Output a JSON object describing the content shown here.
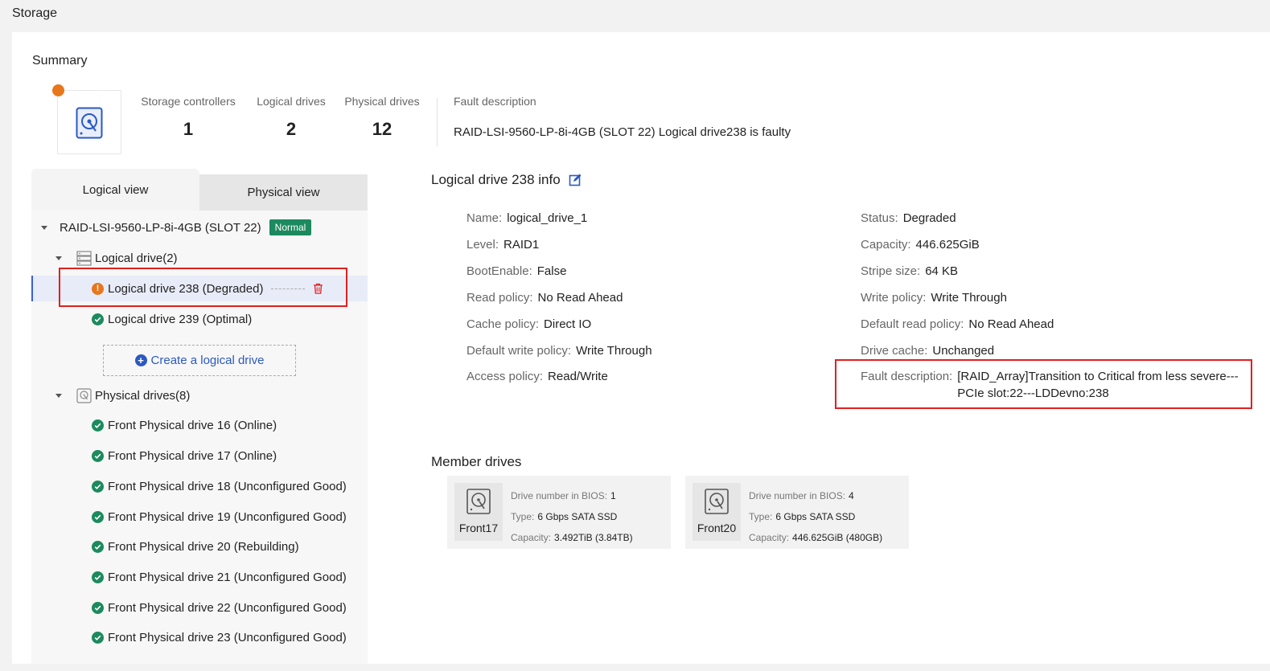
{
  "page": {
    "title": "Storage"
  },
  "summary": {
    "title": "Summary",
    "stats": [
      {
        "label": "Storage controllers",
        "value": "1"
      },
      {
        "label": "Logical drives",
        "value": "2"
      },
      {
        "label": "Physical drives",
        "value": "12"
      }
    ],
    "fault_label": "Fault description",
    "fault_value": "RAID-LSI-9560-LP-8i-4GB (SLOT 22) Logical drive238 is faulty"
  },
  "tabs": {
    "logical": "Logical view",
    "physical": "Physical view"
  },
  "tree": {
    "controller": "RAID-LSI-9560-LP-8i-4GB (SLOT 22)",
    "controller_badge": "Normal",
    "logical_group": "Logical drive(2)",
    "logical_items": [
      "Logical drive 238 (Degraded)",
      "Logical drive 239 (Optimal)"
    ],
    "create_label": "Create a logical drive",
    "physical_group": "Physical drives(8)",
    "physical_items": [
      "Front Physical drive 16 (Online)",
      "Front Physical drive 17 (Online)",
      "Front Physical drive 18 (Unconfigured Good)",
      "Front Physical drive 19 (Unconfigured Good)",
      "Front Physical drive 20 (Rebuilding)",
      "Front Physical drive 21 (Unconfigured Good)",
      "Front Physical drive 22 (Unconfigured Good)",
      "Front Physical drive 23 (Unconfigured Good)"
    ]
  },
  "info": {
    "title": "Logical drive 238 info",
    "left": [
      {
        "k": "Name:",
        "v": "logical_drive_1"
      },
      {
        "k": "Level:",
        "v": "RAID1"
      },
      {
        "k": "BootEnable:",
        "v": "False"
      },
      {
        "k": "Read policy:",
        "v": "No Read Ahead"
      },
      {
        "k": "Cache policy:",
        "v": "Direct IO"
      },
      {
        "k": "Default write policy:",
        "v": "Write Through"
      },
      {
        "k": "Access policy:",
        "v": "Read/Write"
      }
    ],
    "right": [
      {
        "k": "Status:",
        "v": "Degraded"
      },
      {
        "k": "Capacity:",
        "v": "446.625GiB"
      },
      {
        "k": "Stripe size:",
        "v": "64 KB"
      },
      {
        "k": "Write policy:",
        "v": "Write Through"
      },
      {
        "k": "Default read policy:",
        "v": "No Read Ahead"
      },
      {
        "k": "Drive cache:",
        "v": "Unchanged"
      }
    ],
    "fault": {
      "k": "Fault description:",
      "v": "[RAID_Array]Transition to Critical from less severe---PCIe slot:22---LDDevno:238"
    }
  },
  "members": {
    "title": "Member drives",
    "cards": [
      {
        "name": "Front17",
        "bios_k": "Drive number in BIOS:",
        "bios_v": "1",
        "type_k": "Type:",
        "type_v": "6 Gbps SATA SSD",
        "cap_k": "Capacity:",
        "cap_v": "3.492TiB (3.84TB)"
      },
      {
        "name": "Front20",
        "bios_k": "Drive number in BIOS:",
        "bios_v": "4",
        "type_k": "Type:",
        "type_v": "6 Gbps SATA SSD",
        "cap_k": "Capacity:",
        "cap_v": "446.625GiB (480GB)"
      }
    ]
  },
  "colors": {
    "accent": "#2b59c3",
    "ok": "#1c8a5e",
    "warn": "#e8761c",
    "highlight": "#e02020"
  }
}
